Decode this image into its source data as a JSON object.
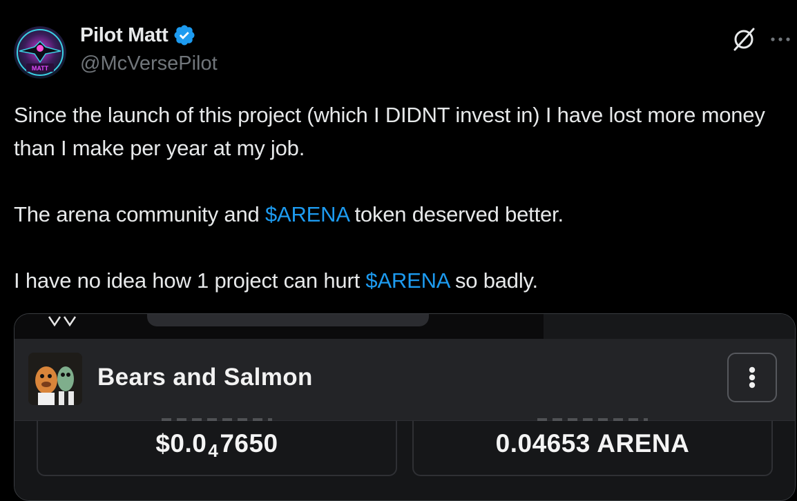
{
  "author": {
    "name": "Pilot Matt",
    "handle": "@McVersePilot",
    "avatar_text": "MATT",
    "verified_icon": "verified-badge-icon"
  },
  "header_icons": {
    "grok": "grok-icon",
    "more": "more-icon"
  },
  "tweet": {
    "line1": "Since the launch of this project (which I DIDNT invest in) I have lost more money than I make per year at my job.",
    "line2_before": "The arena community and ",
    "line2_tag": "$ARENA",
    "line2_after": " token deserved better.",
    "line3_before": "I have no idea how 1 project can hurt ",
    "line3_tag": "$ARENA",
    "line3_after": " so badly."
  },
  "embedded": {
    "token_name": "Bears and Salmon",
    "menu_icon": "kebab-menu-icon",
    "price_usd_prefix": "$0.0",
    "price_usd_sub": "4",
    "price_usd_suffix": "7650",
    "price_arena": "0.04653 ARENA"
  },
  "colors": {
    "background": "#000000",
    "text": "#e7e9ea",
    "secondary": "#71767b",
    "cashtag": "#1d9bf0",
    "verified": "#1d9bf0"
  }
}
